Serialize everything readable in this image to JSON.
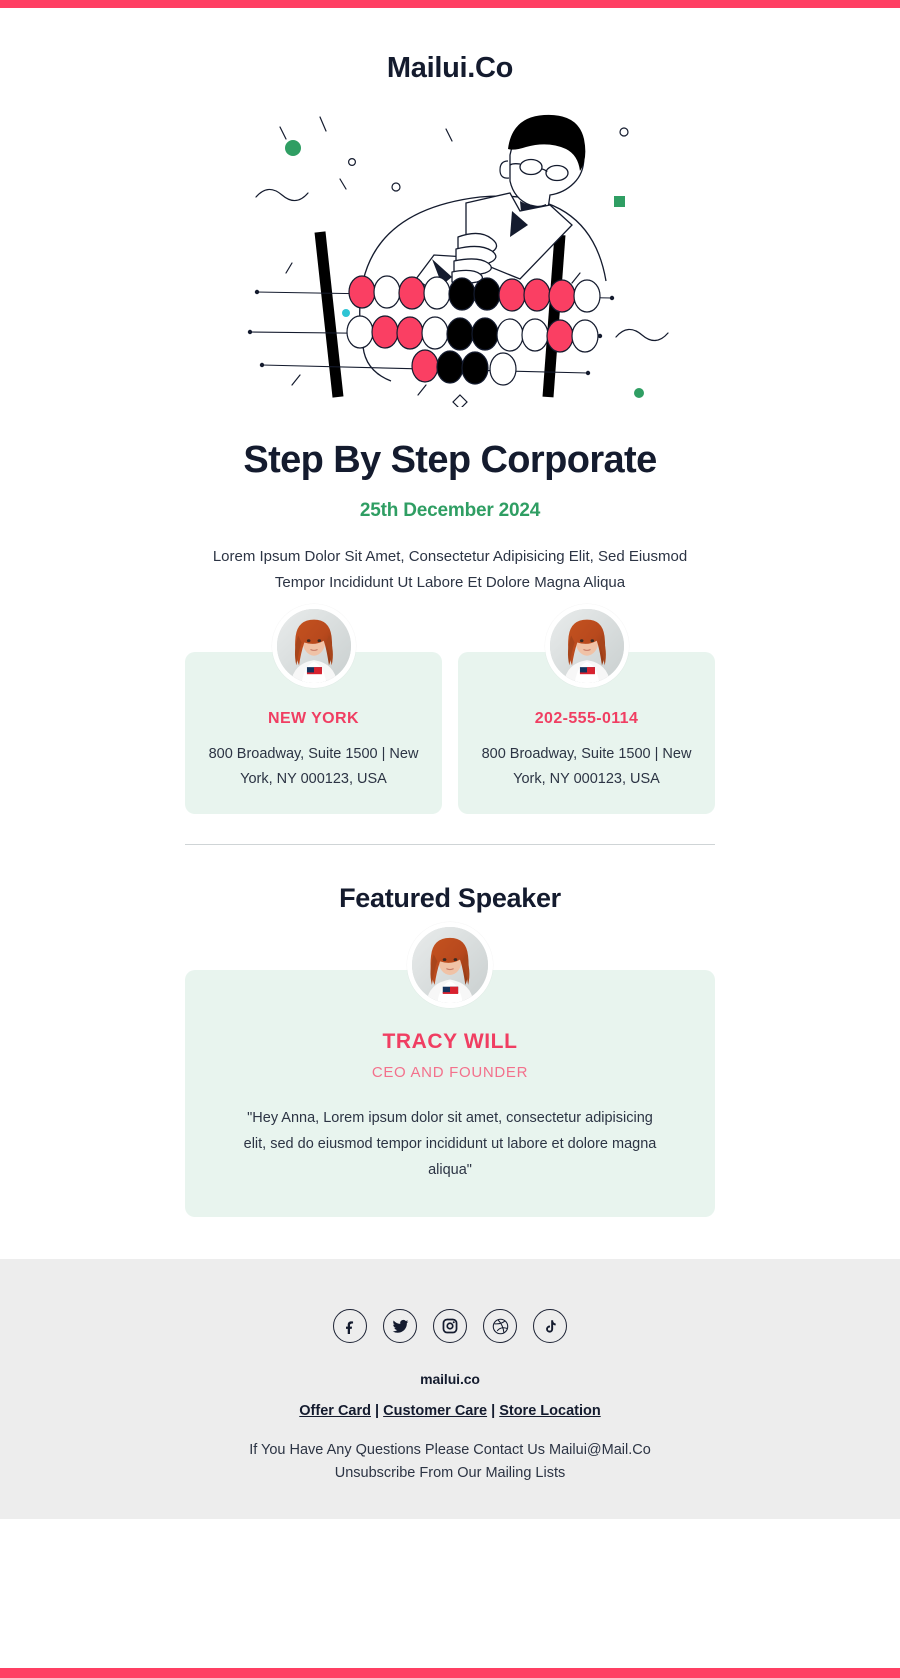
{
  "brand": {
    "logo": "Mailui.Co",
    "accent_pink": "#FF3F63",
    "accent_green": "#2F9E63",
    "navy": "#141B2E",
    "card_bg": "#E8F4EE",
    "footer_bg": "#EDEDED"
  },
  "hero": {
    "illustration_name": "person-using-abacus-illustration"
  },
  "headline": "Step By Step Corporate",
  "date": "25th December 2024",
  "lede": "Lorem Ipsum Dolor Sit Amet, Consectetur Adipisicing Elit, Sed Eiusmod Tempor Incididunt Ut Labore Et Dolore Magna Aliqua",
  "cards": [
    {
      "title": "NEW YORK",
      "address": "800 Broadway, Suite 1500 | New York, NY 000123, USA"
    },
    {
      "title": "202-555-0114",
      "address": "800 Broadway, Suite 1500 | New York, NY 000123, USA"
    }
  ],
  "featured": {
    "section_title": "Featured Speaker",
    "name": "TRACY WILL",
    "role": "CEO AND FOUNDER",
    "quote": "\"Hey Anna, Lorem ipsum dolor sit amet, consectetur adipisicing elit, sed do eiusmod tempor incididunt ut labore et dolore magna aliqua\""
  },
  "footer": {
    "socials": [
      {
        "name": "facebook-icon",
        "label": "Facebook"
      },
      {
        "name": "twitter-icon",
        "label": "Twitter"
      },
      {
        "name": "instagram-icon",
        "label": "Instagram"
      },
      {
        "name": "dribbble-icon",
        "label": "Dribbble"
      },
      {
        "name": "tiktok-icon",
        "label": "TikTok"
      }
    ],
    "brand": "mailui.co",
    "links": [
      {
        "label": "Offer Card"
      },
      {
        "label": "Customer Care"
      },
      {
        "label": "Store Location"
      }
    ],
    "separator": "|",
    "note_line1": "If You Have Any Questions Please Contact Us Mailui@Mail.Co",
    "note_line2": "Unsubscribe From Our Mailing Lists"
  }
}
